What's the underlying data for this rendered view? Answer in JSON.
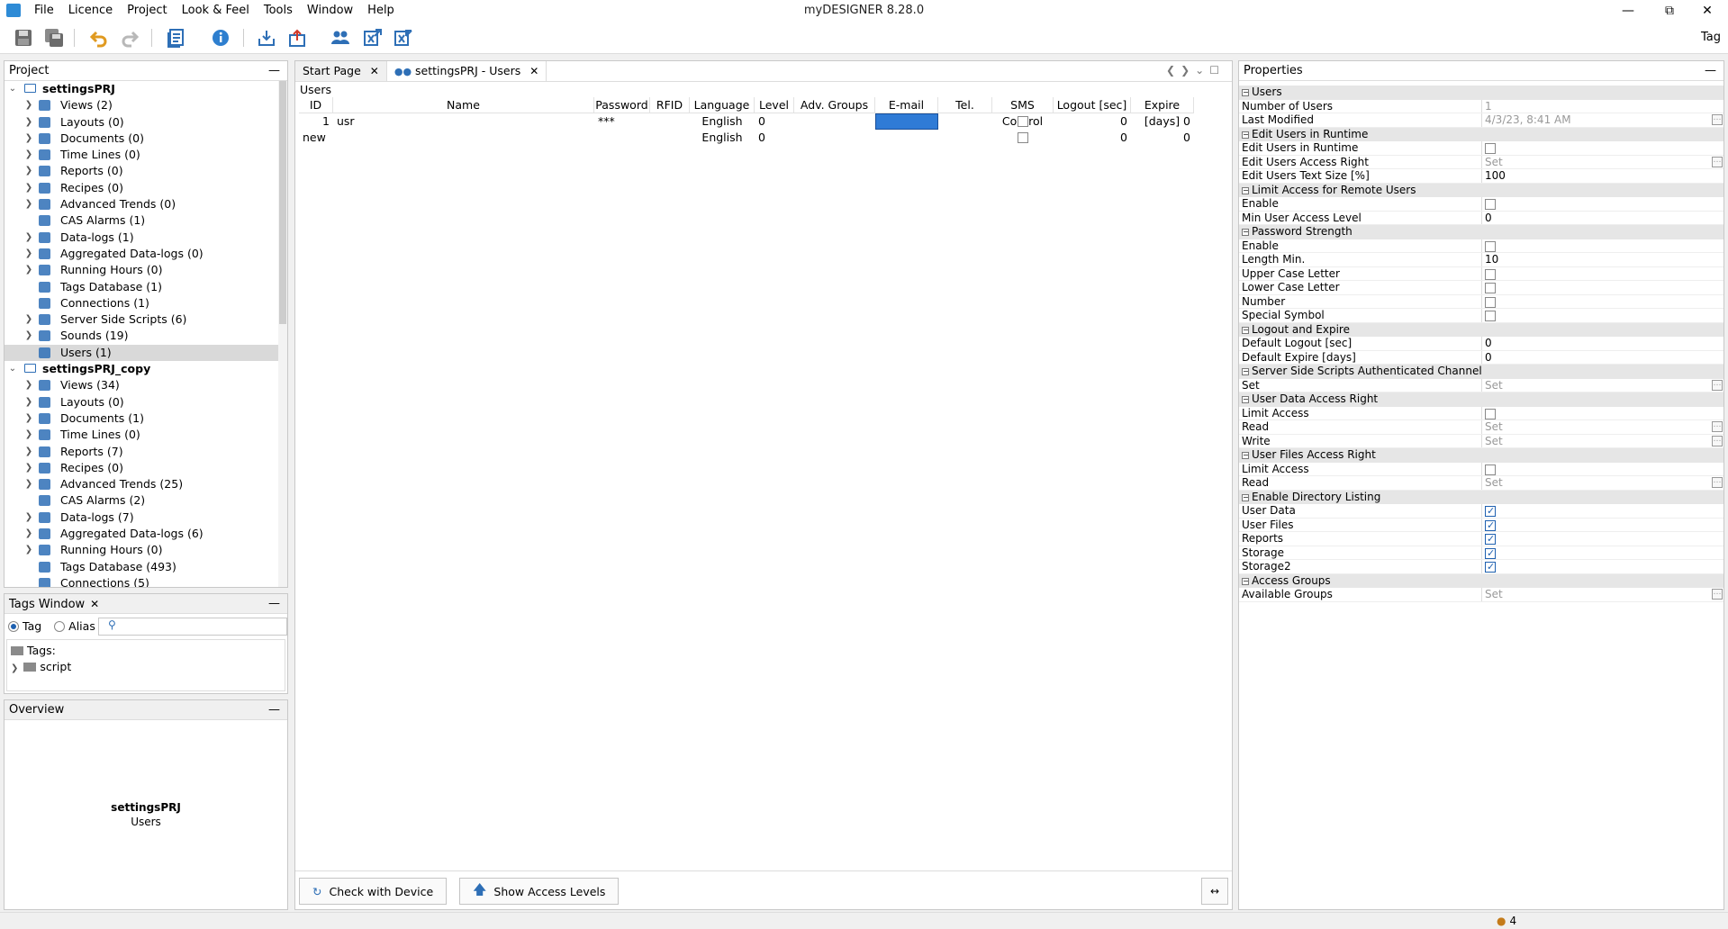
{
  "window": {
    "title": "myDESIGNER 8.28.0"
  },
  "menu": [
    "File",
    "Licence",
    "Project",
    "Look & Feel",
    "Tools",
    "Window",
    "Help"
  ],
  "toolbar": {
    "tag_label": "Tag"
  },
  "project_panel": {
    "title": "Project",
    "projects": [
      {
        "name": "settingsPRJ",
        "items": [
          {
            "label": "Views (2)",
            "icon": "monitor-icon",
            "expand": true
          },
          {
            "label": "Layouts (0)",
            "icon": "layout-icon",
            "expand": true
          },
          {
            "label": "Documents (0)",
            "icon": "document-icon",
            "expand": true
          },
          {
            "label": "Time Lines (0)",
            "icon": "timeline-icon",
            "expand": true
          },
          {
            "label": "Reports (0)",
            "icon": "report-icon",
            "expand": true
          },
          {
            "label": "Recipes (0)",
            "icon": "recipe-icon",
            "expand": true
          },
          {
            "label": "Advanced Trends (0)",
            "icon": "trend-icon",
            "expand": true
          },
          {
            "label": "CAS Alarms (1)",
            "icon": "bell-icon",
            "expand": false
          },
          {
            "label": "Data-logs (1)",
            "icon": "datalog-icon",
            "expand": true
          },
          {
            "label": "Aggregated Data-logs (0)",
            "icon": "datalog-icon",
            "expand": true
          },
          {
            "label": "Running Hours (0)",
            "icon": "clock-icon",
            "expand": true
          },
          {
            "label": "Tags Database (1)",
            "icon": "database-icon",
            "expand": false
          },
          {
            "label": "Connections (1)",
            "icon": "link-icon",
            "expand": false
          },
          {
            "label": "Server Side Scripts (6)",
            "icon": "script-icon",
            "expand": true
          },
          {
            "label": "Sounds (19)",
            "icon": "speaker-icon",
            "expand": true
          },
          {
            "label": "Users (1)",
            "icon": "users-icon",
            "expand": false,
            "selected": true
          }
        ]
      },
      {
        "name": "settingsPRJ_copy",
        "items": [
          {
            "label": "Views (34)",
            "icon": "monitor-icon",
            "expand": true
          },
          {
            "label": "Layouts (0)",
            "icon": "layout-icon",
            "expand": true
          },
          {
            "label": "Documents (1)",
            "icon": "document-icon",
            "expand": true
          },
          {
            "label": "Time Lines (0)",
            "icon": "timeline-icon",
            "expand": true
          },
          {
            "label": "Reports (7)",
            "icon": "report-icon",
            "expand": true
          },
          {
            "label": "Recipes (0)",
            "icon": "recipe-icon",
            "expand": true
          },
          {
            "label": "Advanced Trends (25)",
            "icon": "trend-icon",
            "expand": true
          },
          {
            "label": "CAS Alarms (2)",
            "icon": "bell-icon",
            "expand": false
          },
          {
            "label": "Data-logs (7)",
            "icon": "datalog-icon",
            "expand": true
          },
          {
            "label": "Aggregated Data-logs (6)",
            "icon": "datalog-icon",
            "expand": true
          },
          {
            "label": "Running Hours (0)",
            "icon": "clock-icon",
            "expand": true
          },
          {
            "label": "Tags Database (493)",
            "icon": "database-icon",
            "expand": false
          },
          {
            "label": "Connections (5)",
            "icon": "link-icon",
            "expand": false
          }
        ]
      }
    ]
  },
  "tags_window": {
    "title": "Tags Window",
    "radio_tag": "Tag",
    "radio_alias": "Alias",
    "root": "Tags:",
    "folder": "script"
  },
  "overview": {
    "title": "Overview",
    "project": "settingsPRJ",
    "section": "Users"
  },
  "editor": {
    "tabs": [
      "Start Page",
      "settingsPRJ - Users"
    ],
    "section_label": "Users",
    "columns": [
      "ID",
      "Name",
      "Password",
      "RFID",
      "Language",
      "Level",
      "Adv. Groups",
      "E-mail",
      "Tel.",
      "SMS Control",
      "Logout [sec]",
      "Expire [days]"
    ],
    "rows": [
      {
        "id": "1",
        "name": "usr",
        "password": "***",
        "rfid": "",
        "language": "English",
        "level": "0",
        "adv": "",
        "email": "",
        "tel": "",
        "logout": "0",
        "expire": "0"
      },
      {
        "id": "new",
        "name": "",
        "password": "",
        "rfid": "",
        "language": "English",
        "level": "0",
        "adv": "",
        "email": "",
        "tel": "",
        "logout": "0",
        "expire": "0"
      }
    ],
    "check_button": "Check with Device",
    "access_button": "Show Access Levels"
  },
  "properties": {
    "title": "Properties",
    "groups": [
      {
        "name": "Users",
        "rows": [
          {
            "k": "Number of Users",
            "v": "1",
            "grey": true
          },
          {
            "k": "Last Modified",
            "v": "4/3/23, 8:41 AM",
            "grey": true,
            "dots": true
          }
        ]
      },
      {
        "name": "Edit Users in Runtime",
        "rows": [
          {
            "k": "Edit Users in Runtime",
            "cb": false
          },
          {
            "k": "Edit Users Access Right",
            "v": "Set",
            "grey": true,
            "dots": true
          },
          {
            "k": "Edit Users Text Size [%]",
            "v": "100"
          }
        ]
      },
      {
        "name": "Limit Access for Remote Users",
        "rows": [
          {
            "k": "Enable",
            "cb": false
          },
          {
            "k": "Min User Access Level",
            "v": "0"
          }
        ]
      },
      {
        "name": "Password Strength",
        "rows": [
          {
            "k": "Enable",
            "cb": false
          },
          {
            "k": "Length Min.",
            "v": "10"
          },
          {
            "k": "Upper Case Letter",
            "cb": false
          },
          {
            "k": "Lower Case Letter",
            "cb": false
          },
          {
            "k": "Number",
            "cb": false
          },
          {
            "k": "Special Symbol",
            "cb": false
          }
        ]
      },
      {
        "name": "Logout and Expire",
        "rows": [
          {
            "k": "Default Logout [sec]",
            "v": "0"
          },
          {
            "k": "Default Expire [days]",
            "v": "0"
          }
        ]
      },
      {
        "name": "Server Side Scripts Authenticated Channel",
        "rows": [
          {
            "k": "Set",
            "v": "Set",
            "grey": true,
            "dots": true
          }
        ]
      },
      {
        "name": "User Data Access Right",
        "rows": [
          {
            "k": "Limit Access",
            "cb": false
          },
          {
            "k": "Read",
            "v": "Set",
            "grey": true,
            "dots": true
          },
          {
            "k": "Write",
            "v": "Set",
            "grey": true,
            "dots": true
          }
        ]
      },
      {
        "name": "User Files Access Right",
        "rows": [
          {
            "k": "Limit Access",
            "cb": false
          },
          {
            "k": "Read",
            "v": "Set",
            "grey": true,
            "dots": true
          }
        ]
      },
      {
        "name": "Enable Directory Listing",
        "rows": [
          {
            "k": "User Data",
            "cb": true
          },
          {
            "k": "User Files",
            "cb": true
          },
          {
            "k": "Reports",
            "cb": true
          },
          {
            "k": "Storage",
            "cb": true
          },
          {
            "k": "Storage2",
            "cb": true
          }
        ]
      },
      {
        "name": "Access Groups",
        "rows": [
          {
            "k": "Available Groups",
            "v": "Set",
            "grey": true,
            "dots": true
          }
        ]
      }
    ]
  },
  "status": {
    "count": "4"
  }
}
